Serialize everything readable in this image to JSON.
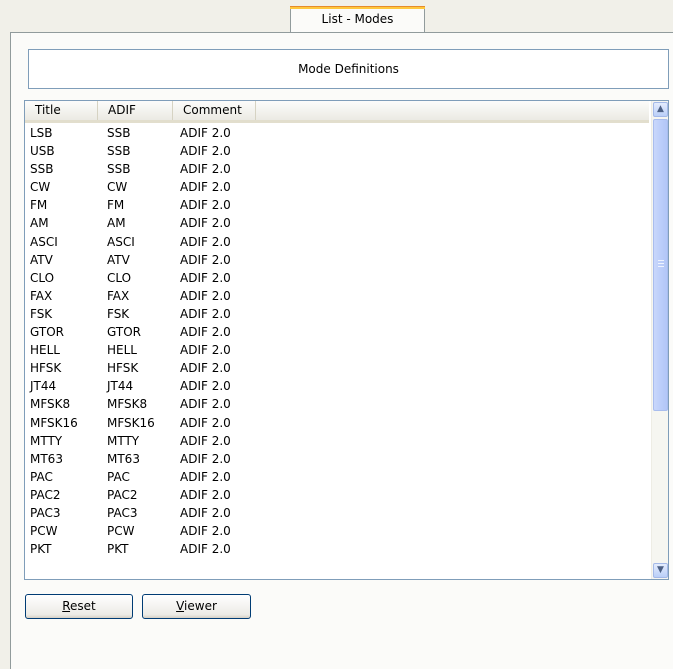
{
  "tab": {
    "label": "List - Modes"
  },
  "panel": {
    "heading": "Mode Definitions"
  },
  "table": {
    "columns": [
      "Title",
      "ADIF",
      "Comment"
    ],
    "rows": [
      [
        "LSB",
        "SSB",
        "ADIF 2.0"
      ],
      [
        "USB",
        "SSB",
        "ADIF 2.0"
      ],
      [
        "SSB",
        "SSB",
        "ADIF 2.0"
      ],
      [
        "CW",
        "CW",
        "ADIF 2.0"
      ],
      [
        "FM",
        "FM",
        "ADIF 2.0"
      ],
      [
        "AM",
        "AM",
        "ADIF 2.0"
      ],
      [
        "ASCI",
        "ASCI",
        "ADIF 2.0"
      ],
      [
        "ATV",
        "ATV",
        "ADIF 2.0"
      ],
      [
        "CLO",
        "CLO",
        "ADIF 2.0"
      ],
      [
        "FAX",
        "FAX",
        "ADIF 2.0"
      ],
      [
        "FSK",
        "FSK",
        "ADIF 2.0"
      ],
      [
        "GTOR",
        "GTOR",
        "ADIF 2.0"
      ],
      [
        "HELL",
        "HELL",
        "ADIF 2.0"
      ],
      [
        "HFSK",
        "HFSK",
        "ADIF 2.0"
      ],
      [
        "JT44",
        "JT44",
        "ADIF 2.0"
      ],
      [
        "MFSK8",
        "MFSK8",
        "ADIF 2.0"
      ],
      [
        "MFSK16",
        "MFSK16",
        "ADIF 2.0"
      ],
      [
        "MTTY",
        "MTTY",
        "ADIF 2.0"
      ],
      [
        "MT63",
        "MT63",
        "ADIF 2.0"
      ],
      [
        "PAC",
        "PAC",
        "ADIF 2.0"
      ],
      [
        "PAC2",
        "PAC2",
        "ADIF 2.0"
      ],
      [
        "PAC3",
        "PAC3",
        "ADIF 2.0"
      ],
      [
        "PCW",
        "PCW",
        "ADIF 2.0"
      ],
      [
        "PKT",
        "PKT",
        "ADIF 2.0"
      ]
    ]
  },
  "buttons": {
    "reset": {
      "accel": "R",
      "rest": "eset"
    },
    "viewer": {
      "accel": "V",
      "rest": "iewer"
    }
  },
  "icons": {
    "scroll_up": "scroll-up-arrow-icon",
    "scroll_down": "scroll-down-arrow-icon"
  }
}
